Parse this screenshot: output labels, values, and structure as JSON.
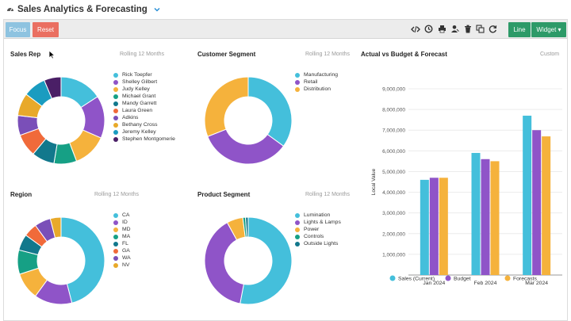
{
  "app": {
    "title": "Sales Analytics & Forecasting"
  },
  "toolbar": {
    "focus_label": "Focus",
    "reset_label": "Reset",
    "line_label": "Line",
    "widget_label": "Widget ▾",
    "tools": [
      "code-icon",
      "history-icon",
      "print-icon",
      "user-icon",
      "trash-icon",
      "copy-icon",
      "refresh-icon"
    ]
  },
  "colors": {
    "accent_green": "#2d9a68",
    "focus_blue": "#8ec3e0",
    "reset_red": "#ea6f61"
  },
  "panels": {
    "sales_rep": {
      "title": "Sales Rep",
      "subtitle": "Rolling 12 Months"
    },
    "customer_segment": {
      "title": "Customer Segment",
      "subtitle": "Rolling 12 Months"
    },
    "region": {
      "title": "Region",
      "subtitle": "Rolling 12 Months"
    },
    "product_segment": {
      "title": "Product Segment",
      "subtitle": "Rolling 12 Months"
    },
    "actual_vs_budget": {
      "title": "Actual vs Budget & Forecast",
      "subtitle": "Custom"
    }
  },
  "chart_data": [
    {
      "id": "sales_rep",
      "type": "pie",
      "title": "Sales Rep",
      "categories": [
        "Rick Toepfer",
        "Shelley Gilbert",
        "Judy Kelley",
        "Michael Grant",
        "Mandy Garrett",
        "Laura Green",
        "Adkins",
        "Bethany Cross",
        "Jeremy Kelley",
        "Stephen Montgomerie"
      ],
      "values": [
        15,
        15,
        12,
        8,
        8,
        8,
        7,
        8,
        8,
        6
      ],
      "colors": [
        "#44bfdb",
        "#8f54c8",
        "#f5b23c",
        "#16a085",
        "#12788c",
        "#f06a3a",
        "#7a4fb8",
        "#e8a92a",
        "#1a9cc0",
        "#4a1f66"
      ],
      "start_angle": 0,
      "legend_position": "right"
    },
    {
      "id": "customer_segment",
      "type": "pie",
      "title": "Customer Segment",
      "categories": [
        "Manufacturing",
        "Retail",
        "Distribution"
      ],
      "values": [
        35,
        34,
        31
      ],
      "colors": [
        "#44bfdb",
        "#8f54c8",
        "#f5b23c"
      ],
      "start_angle": 0,
      "legend_position": "right"
    },
    {
      "id": "region",
      "type": "pie",
      "title": "Region",
      "categories": [
        "CA",
        "ID",
        "MD",
        "MA",
        "FL",
        "GA",
        "WA",
        "NV"
      ],
      "values": [
        46,
        14,
        10,
        9,
        6,
        5,
        6,
        4
      ],
      "colors": [
        "#44bfdb",
        "#8f54c8",
        "#f5b23c",
        "#16a085",
        "#12788c",
        "#f06a3a",
        "#7a4fb8",
        "#e8a92a"
      ],
      "start_angle": 0,
      "legend_position": "right"
    },
    {
      "id": "product_segment",
      "type": "pie",
      "title": "Product Segment",
      "categories": [
        "Lumination",
        "Lights & Lamps",
        "Power",
        "Controls",
        "Outside Lights"
      ],
      "values": [
        53,
        39,
        6,
        1,
        1
      ],
      "colors": [
        "#44bfdb",
        "#8f54c8",
        "#f5b23c",
        "#16a085",
        "#12788c"
      ],
      "start_angle": 0,
      "legend_position": "right"
    },
    {
      "id": "actual_vs_budget",
      "type": "bar",
      "title": "Actual vs Budget & Forecast",
      "categories": [
        "Jan 2024",
        "Feb 2024",
        "Mar 2024"
      ],
      "series": [
        {
          "name": "Sales (Current)",
          "color": "#44bfdb",
          "values": [
            4600000,
            5900000,
            7700000
          ]
        },
        {
          "name": "Budget",
          "color": "#8f54c8",
          "values": [
            4700000,
            5600000,
            7000000
          ]
        },
        {
          "name": "Forecasts",
          "color": "#f5b23c",
          "values": [
            4700000,
            5500000,
            6700000
          ]
        }
      ],
      "ylabel": "Local Value",
      "ylim": [
        0,
        9000000
      ],
      "yticks": [
        "1,000,000",
        "2,000,000",
        "3,000,000",
        "4,000,000",
        "5,000,000",
        "6,000,000",
        "7,000,000",
        "8,000,000",
        "9,000,000"
      ],
      "grid": true,
      "legend_position": "bottom"
    }
  ]
}
